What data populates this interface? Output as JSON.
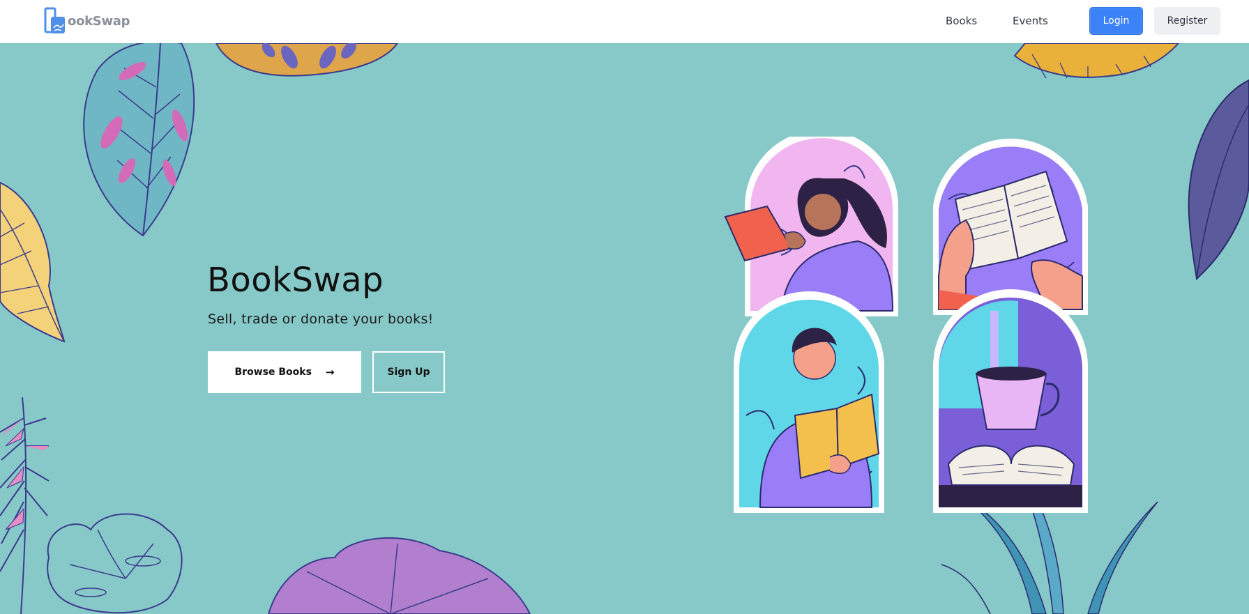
{
  "brand": {
    "name": "ookSwap",
    "logo_icon": "book-logo-icon"
  },
  "nav": {
    "books": "Books",
    "events": "Events",
    "login": "Login",
    "register": "Register"
  },
  "hero": {
    "title": "BookSwap",
    "subtitle": "Sell, trade or donate your books!",
    "browse_label": "Browse Books",
    "browse_arrow": "→",
    "signup_label": "Sign Up"
  },
  "colors": {
    "background": "#87c9c8",
    "accent": "#3b82f6",
    "leaf_purple": "#b27fcf",
    "leaf_yellow": "#f4d27a",
    "leaf_orange": "#dfa54a",
    "outline": "#3a3a8c"
  }
}
